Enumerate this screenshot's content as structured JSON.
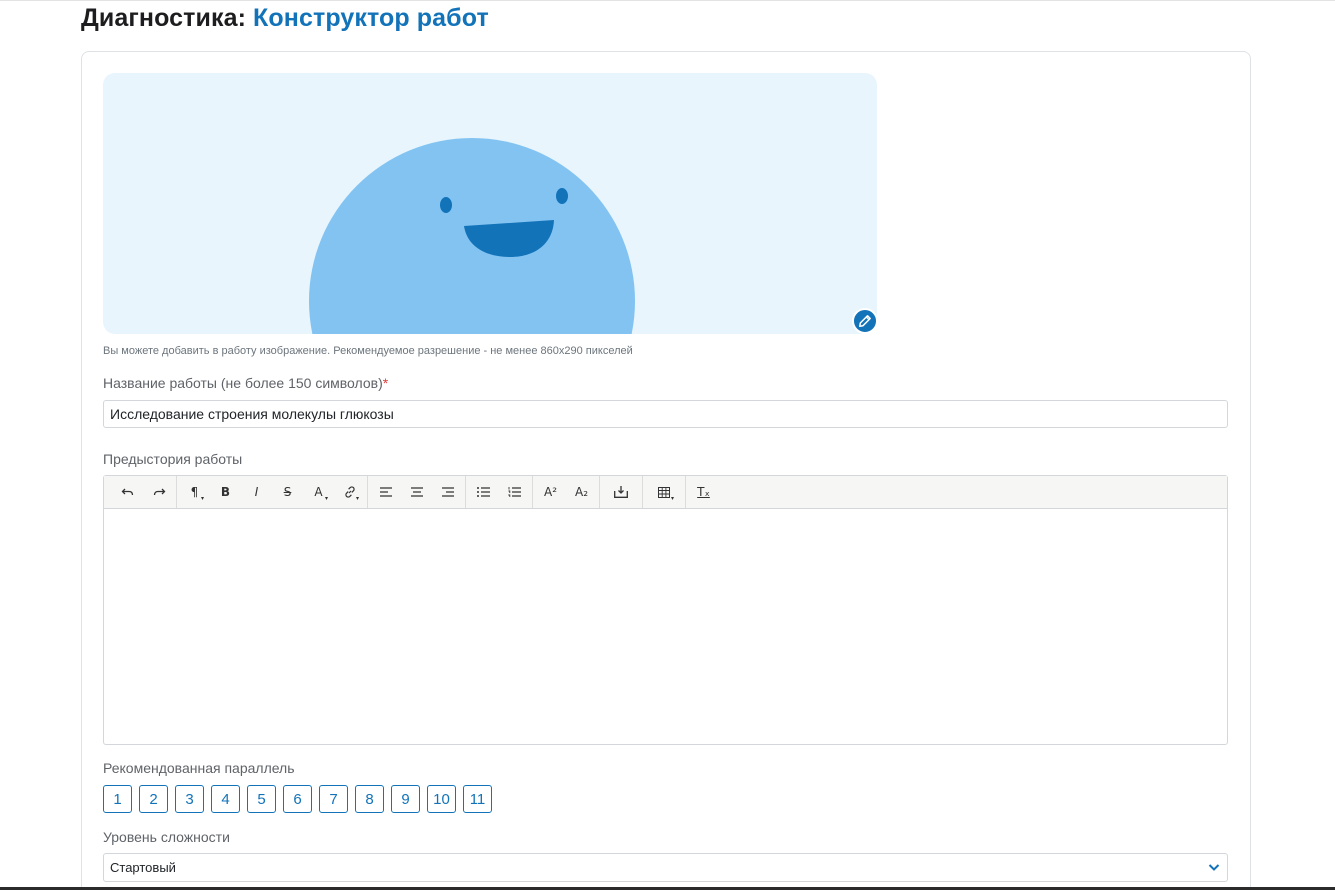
{
  "header": {
    "title_prefix": "Диагностика:",
    "title_accent": "Конструктор работ"
  },
  "colors": {
    "accent": "#1273b9",
    "banner_bg": "#e8f5fd",
    "character_body": "#82c3f2",
    "required_star": "#e23a3a"
  },
  "image_section": {
    "edit_icon": "pencil-icon",
    "hint": "Вы можете добавить в работу изображение. Рекомендуемое разрешение - не менее 860x290 пикселей"
  },
  "title_field": {
    "label": "Название работы (не более 150 символов)",
    "required_mark": "*",
    "value": "Исследование строения молекулы глюкозы"
  },
  "backstory": {
    "label": "Предыстория работы",
    "content": "",
    "toolbar": {
      "undo": "↶",
      "redo": "↷",
      "paragraph": "¶",
      "bold": "B",
      "italic": "I",
      "strike": "S",
      "font_color": "A",
      "link": "🔗",
      "align_left": "align-left-icon",
      "align_center": "align-center-icon",
      "align_right": "align-right-icon",
      "bullet_list": "bullet-list-icon",
      "numbered_list": "numbered-list-icon",
      "superscript": "A²",
      "subscript": "A₂",
      "insert": "insert-icon",
      "table": "table-icon",
      "clear_format": "Tₓ"
    }
  },
  "grade": {
    "label": "Рекомендованная параллель",
    "options": [
      "1",
      "2",
      "3",
      "4",
      "5",
      "6",
      "7",
      "8",
      "9",
      "10",
      "11"
    ]
  },
  "difficulty": {
    "label": "Уровень сложности",
    "selected": "Стартовый"
  }
}
